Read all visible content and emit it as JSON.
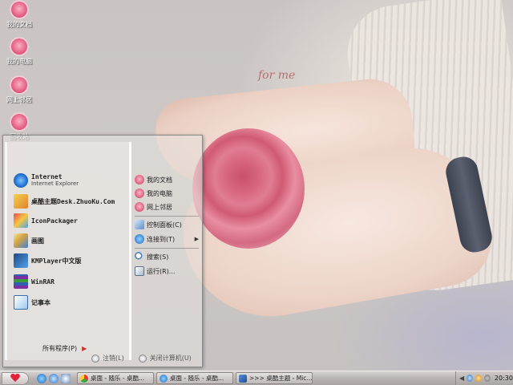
{
  "desktop": {
    "icons": [
      {
        "label": "我的文档",
        "icon": "rose-folder-icon"
      },
      {
        "label": "我的电脑",
        "icon": "rose-computer-icon"
      },
      {
        "label": "网上邻居",
        "icon": "rose-network-icon"
      },
      {
        "label": "回收站",
        "icon": "rose-recycle-icon"
      }
    ],
    "wallpaper_text": "for me"
  },
  "start_menu": {
    "programs": [
      {
        "title": "Internet",
        "subtitle": "Internet Explorer",
        "icon": "ie-icon"
      },
      {
        "title": "桌酷主题Desk.ZhuoKu.Com",
        "icon": "zhuoku-icon"
      },
      {
        "title": "IconPackager",
        "icon": "iconpackager-icon"
      },
      {
        "title": "画图",
        "icon": "paint-icon"
      },
      {
        "title": "KMPlayer中文版",
        "icon": "kmplayer-icon"
      },
      {
        "title": "WinRAR",
        "icon": "winrar-icon"
      },
      {
        "title": "记事本",
        "icon": "notepad-icon"
      }
    ],
    "all_programs": "所有程序(P)",
    "right": {
      "my_documents": "我的文档",
      "my_computer": "我的电脑",
      "network_places": "网上邻居",
      "control_panel": "控制面板(C)",
      "connect_to": "连接到(T)",
      "search": "搜索(S)",
      "run": "运行(R)..."
    },
    "bottom": {
      "logoff": "注销(L)",
      "shutdown": "关闭计算机(U)"
    }
  },
  "taskbar": {
    "tasks": [
      {
        "label": "桌面 - 随乐 - 桌酷...",
        "icon": "chrome-icon"
      },
      {
        "label": "桌面 - 随乐 - 桌酷...",
        "icon": "ie-icon"
      },
      {
        "label": ">>> 桌酷主题 - Mic...",
        "icon": "word-icon"
      }
    ],
    "clock": "20:30"
  },
  "colors": {
    "accent_pink": "#e06889",
    "taskbar": "#bdb8b6",
    "start_heart": "#e2223a"
  }
}
